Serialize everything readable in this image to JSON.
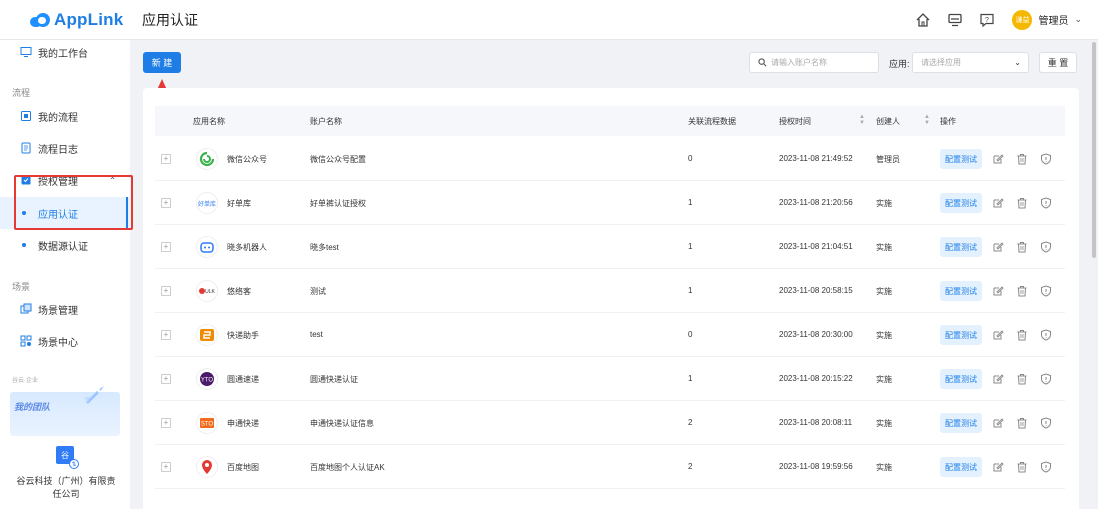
{
  "brand": {
    "name": "AppLink"
  },
  "header": {
    "title": "应用认证",
    "avatar_text": "谦益",
    "user_name": "管理员"
  },
  "sidebar": {
    "workbench": "我的工作台",
    "section_flow": "流程",
    "my_flow": "我的流程",
    "flow_log": "流程日志",
    "auth_manage": "授权管理",
    "app_auth": "应用认证",
    "datasource_auth": "数据源认证",
    "section_scene": "场景",
    "scene_manage": "场景管理",
    "scene_center": "场景中心",
    "small_tag": "谷云·企业",
    "team_title": "我的团队",
    "company_logo": "谷",
    "company_name": "谷云科技（广州）有限责任公司"
  },
  "toolbar": {
    "new_label": "新 建",
    "search_placeholder": "请输入账户名称",
    "filter_label": "应用:",
    "select_placeholder": "请选择应用",
    "reset_label": "重 置"
  },
  "table": {
    "columns": {
      "app_name": "应用名称",
      "account_name": "账户名称",
      "flow_count": "关联流程数据",
      "auth_time": "授权时间",
      "creator": "创建人",
      "actions": "操作"
    },
    "test_label": "配置测试",
    "rows": [
      {
        "app": "微信公众号",
        "account": "微信公众号配置",
        "count": "0",
        "time": "2023-11-08 21:49:52",
        "creator": "管理员",
        "logo": "wechat"
      },
      {
        "app": "好单库",
        "account": "好单裤认证授权",
        "count": "1",
        "time": "2023-11-08 21:20:56",
        "creator": "实施",
        "logo": "haodanku"
      },
      {
        "app": "晓多机器人",
        "account": "晓多test",
        "count": "1",
        "time": "2023-11-08 21:04:51",
        "creator": "实施",
        "logo": "robot"
      },
      {
        "app": "悠络客",
        "account": "测试",
        "count": "1",
        "time": "2023-11-08 20:58:15",
        "creator": "实施",
        "logo": "youluoke"
      },
      {
        "app": "快递助手",
        "account": "test",
        "count": "0",
        "time": "2023-11-08 20:30:00",
        "creator": "实施",
        "logo": "express"
      },
      {
        "app": "圆通速递",
        "account": "圆通快递认证",
        "count": "1",
        "time": "2023-11-08 20:15:22",
        "creator": "实施",
        "logo": "yto"
      },
      {
        "app": "申通快递",
        "account": "申通快递认证信息",
        "count": "2",
        "time": "2023-11-08 20:08:11",
        "creator": "实施",
        "logo": "sto"
      },
      {
        "app": "百度地图",
        "account": "百度地图个人认证AK",
        "count": "2",
        "time": "2023-11-08 19:59:56",
        "creator": "实施",
        "logo": "baidumap"
      }
    ]
  }
}
